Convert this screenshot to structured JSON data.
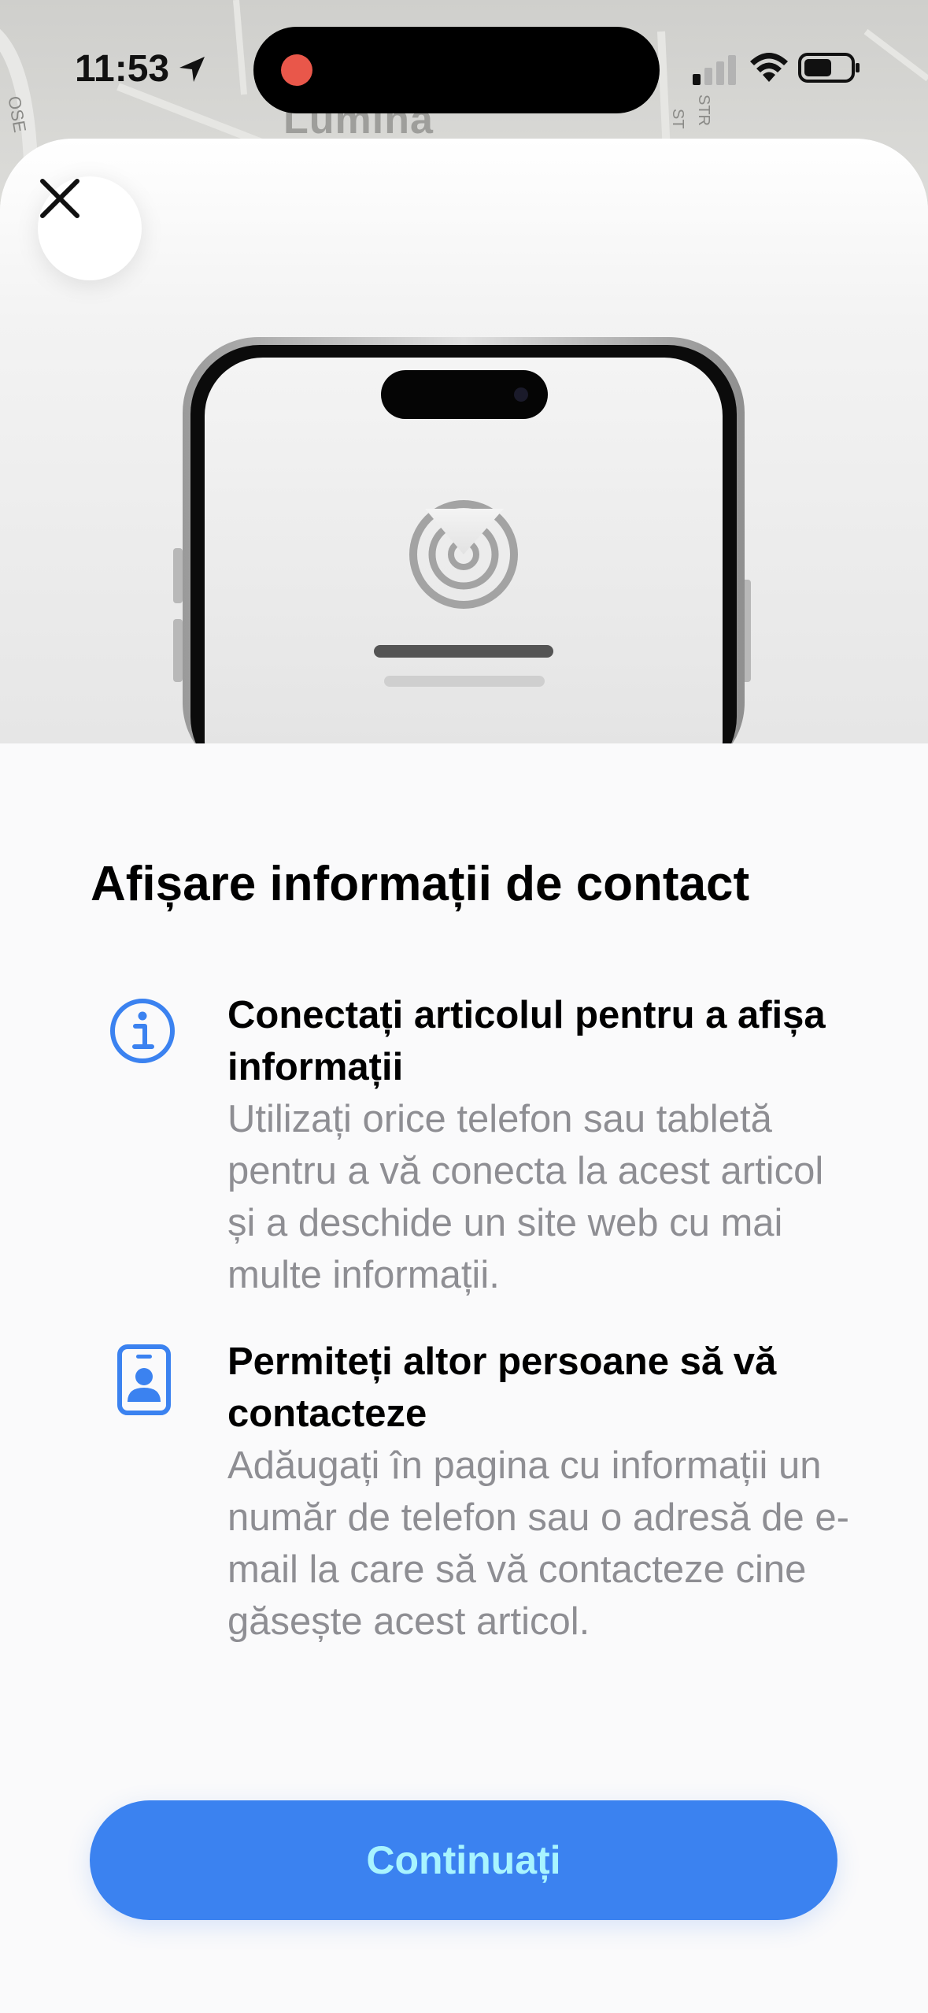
{
  "status_bar": {
    "time": "11:53",
    "icons": [
      "location-arrow-icon",
      "signal-icon",
      "wifi-icon",
      "battery-icon"
    ]
  },
  "map": {
    "label": "Lumina",
    "small_labels": [
      "OSE",
      "STR",
      "ST"
    ]
  },
  "sheet": {
    "close_icon": "close-icon",
    "title": "Afișare informații de contact",
    "features": [
      {
        "icon": "info-circle-icon",
        "title": "Conectați articolul pentru a afișa informații",
        "body": "Utilizați orice telefon sau tabletă pentru a vă conecta la acest articol și a deschide un site web cu mai multe informații."
      },
      {
        "icon": "contact-card-icon",
        "title": "Permiteți altor persoane să vă contacteze",
        "body": "Adăugați în pagina cu informații un număr de telefon sau o adresă de e-mail la care să vă contacteze cine găsește acest articol."
      }
    ],
    "continue_label": "Continuați"
  },
  "colors": {
    "accent": "#3b82f0",
    "button_text": "#a8f4ff",
    "secondary_text": "#8e8e93",
    "record_dot": "#e9574a"
  }
}
